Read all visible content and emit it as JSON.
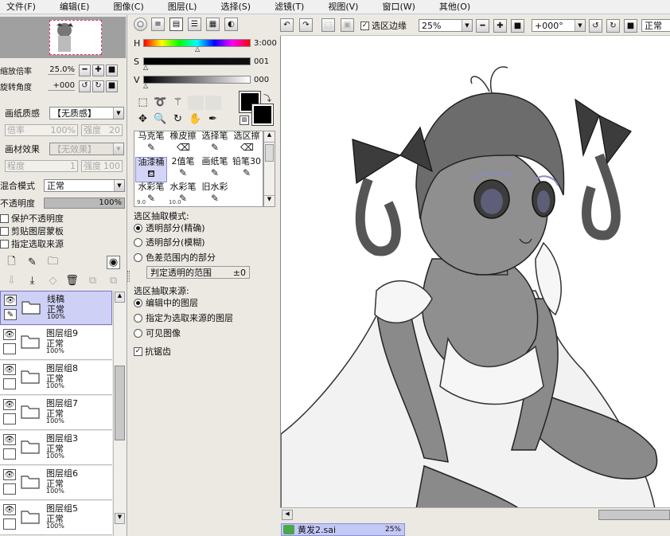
{
  "menu": [
    "文件(F)",
    "编辑(E)",
    "图像(C)",
    "图层(L)",
    "选择(S)",
    "滤镜(T)",
    "视图(V)",
    "窗口(W)",
    "其他(O)"
  ],
  "navigator": {
    "zoom_label": "缩放倍率",
    "zoom_value": "25.0%",
    "rotate_label": "旋转角度",
    "rotate_value": "+000"
  },
  "paper": {
    "texture_label": "画纸质感",
    "texture_value": "【无质感】",
    "scale_label": "倍率",
    "scale_value": "100%",
    "strength_label": "强度",
    "strength_value": "20",
    "effect_label": "画材效果",
    "effect_value": "【无效果】",
    "degree_label": "程度",
    "degree_value": "1",
    "effect_strength_label": "强度",
    "effect_strength_value": "100"
  },
  "blend": {
    "label": "混合模式",
    "value": "正常",
    "opacity_label": "不透明度",
    "opacity_value": "100%",
    "opacity_fraction": 1.0
  },
  "layer_options": [
    "保护不透明度",
    "剪贴图层蒙板",
    "指定选取来源"
  ],
  "layers": [
    {
      "name": "线稿",
      "mode": "正常",
      "opacity": "100%",
      "selected": true
    },
    {
      "name": "图层组9",
      "mode": "正常",
      "opacity": "100%",
      "selected": false
    },
    {
      "name": "图层组8",
      "mode": "正常",
      "opacity": "100%",
      "selected": false
    },
    {
      "name": "图层组7",
      "mode": "正常",
      "opacity": "100%",
      "selected": false
    },
    {
      "name": "图层组3",
      "mode": "正常",
      "opacity": "100%",
      "selected": false
    },
    {
      "name": "图层组6",
      "mode": "正常",
      "opacity": "100%",
      "selected": false
    },
    {
      "name": "图层组5",
      "mode": "正常",
      "opacity": "100%",
      "selected": false
    }
  ],
  "color": {
    "h_label": "H",
    "h_value": "3:000",
    "s_label": "S",
    "s_value": "001",
    "v_label": "V",
    "v_value": "000",
    "fg": "#000000",
    "bg": "#ffffff"
  },
  "brushes": [
    {
      "label": "马克笔",
      "size": ""
    },
    {
      "label": "橡皮擦",
      "size": ""
    },
    {
      "label": "选择笔",
      "size": ""
    },
    {
      "label": "选区擦",
      "size": ""
    },
    {
      "label": "油漆桶",
      "size": ""
    },
    {
      "label": "2值笔",
      "size": ""
    },
    {
      "label": "画纸笔",
      "size": ""
    },
    {
      "label": "铅笔30",
      "size": ""
    },
    {
      "label": "水彩笔",
      "size": "9.0"
    },
    {
      "label": "水彩笔",
      "size": "10.0"
    },
    {
      "label": "旧水彩",
      "size": ""
    }
  ],
  "selection": {
    "mode_title": "选区抽取模式:",
    "modes": [
      "透明部分(精确)",
      "透明部分(模糊)",
      "色差范围内的部分"
    ],
    "range_label": "判定透明的范围",
    "range_value": "±0",
    "source_title": "选区抽取来源:",
    "sources": [
      "编辑中的图层",
      "指定为选取来源的图层",
      "可见图像"
    ],
    "antialias_label": "抗锯齿"
  },
  "toolbar": {
    "selection_edge_label": "选区边缘",
    "zoom_value": "25%",
    "angle_value": "+000°",
    "blend_value": "正常"
  },
  "document": {
    "tab_name": "黄发2.sai",
    "tab_zoom": "25%"
  }
}
